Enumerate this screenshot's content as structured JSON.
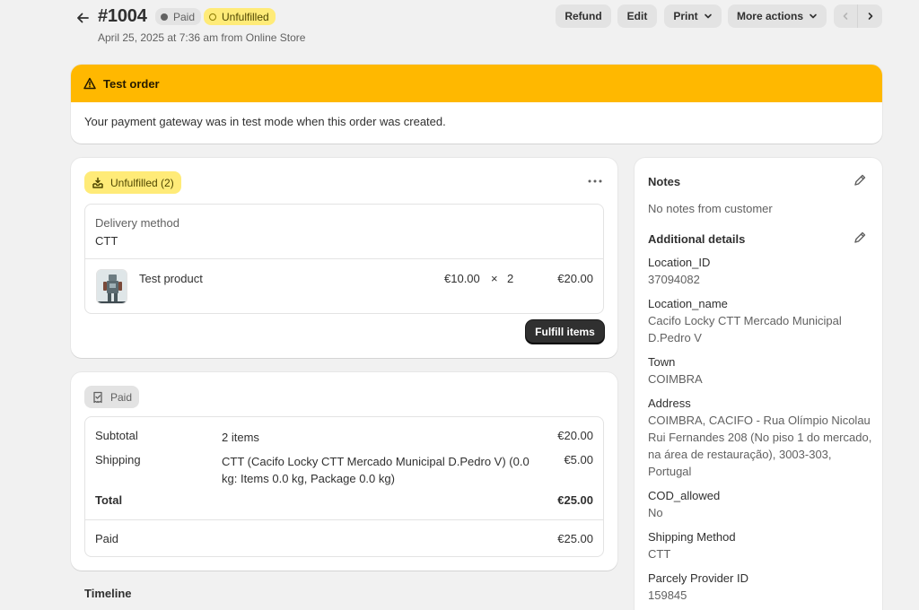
{
  "header": {
    "order_number": "#1004",
    "payment_badge": "Paid",
    "fulfillment_badge": "Unfulfilled",
    "subtitle": "April 25, 2025 at 7:36 am from Online Store",
    "buttons": {
      "refund": "Refund",
      "edit": "Edit",
      "print": "Print",
      "more": "More actions"
    }
  },
  "banner": {
    "title": "Test order",
    "message": "Your payment gateway was in test mode when this order was created.",
    "color": "#ffb800"
  },
  "fulfillment": {
    "status_label": "Unfulfilled (2)",
    "delivery_method_label": "Delivery method",
    "delivery_method_value": "CTT",
    "product": {
      "name": "Test product",
      "price": "€10.00",
      "times": "×",
      "quantity": "2",
      "total": "€20.00"
    },
    "fulfill_button": "Fulfill items"
  },
  "payment": {
    "status_label": "Paid",
    "rows": {
      "subtotal": {
        "label": "Subtotal",
        "detail": "2 items",
        "amount": "€20.00"
      },
      "shipping": {
        "label": "Shipping",
        "detail": "CTT (Cacifo Locky CTT Mercado Municipal D.Pedro V) (0.0 kg: Items 0.0 kg, Package 0.0 kg)",
        "amount": "€5.00"
      },
      "total": {
        "label": "Total",
        "amount": "€25.00"
      },
      "paid": {
        "label": "Paid",
        "amount": "€25.00"
      }
    }
  },
  "timeline": {
    "title": "Timeline"
  },
  "sidebar": {
    "notes_title": "Notes",
    "notes_text": "No notes from customer",
    "additional_title": "Additional details",
    "details": [
      {
        "key": "Location_ID",
        "value": "37094082"
      },
      {
        "key": "Location_name",
        "value": "Cacifo Locky CTT Mercado Municipal D.Pedro V"
      },
      {
        "key": "Town",
        "value": "COIMBRA"
      },
      {
        "key": "Address",
        "value": "COIMBRA, CACIFO - Rua Olímpio Nicolau Rui Fernandes 208 (No piso 1 do mercado, na área de restauração), 3003-303, Portugal"
      },
      {
        "key": "COD_allowed",
        "value": "No"
      },
      {
        "key": "Shipping Method",
        "value": "CTT"
      },
      {
        "key": "Parcely Provider ID",
        "value": "159845"
      }
    ]
  }
}
